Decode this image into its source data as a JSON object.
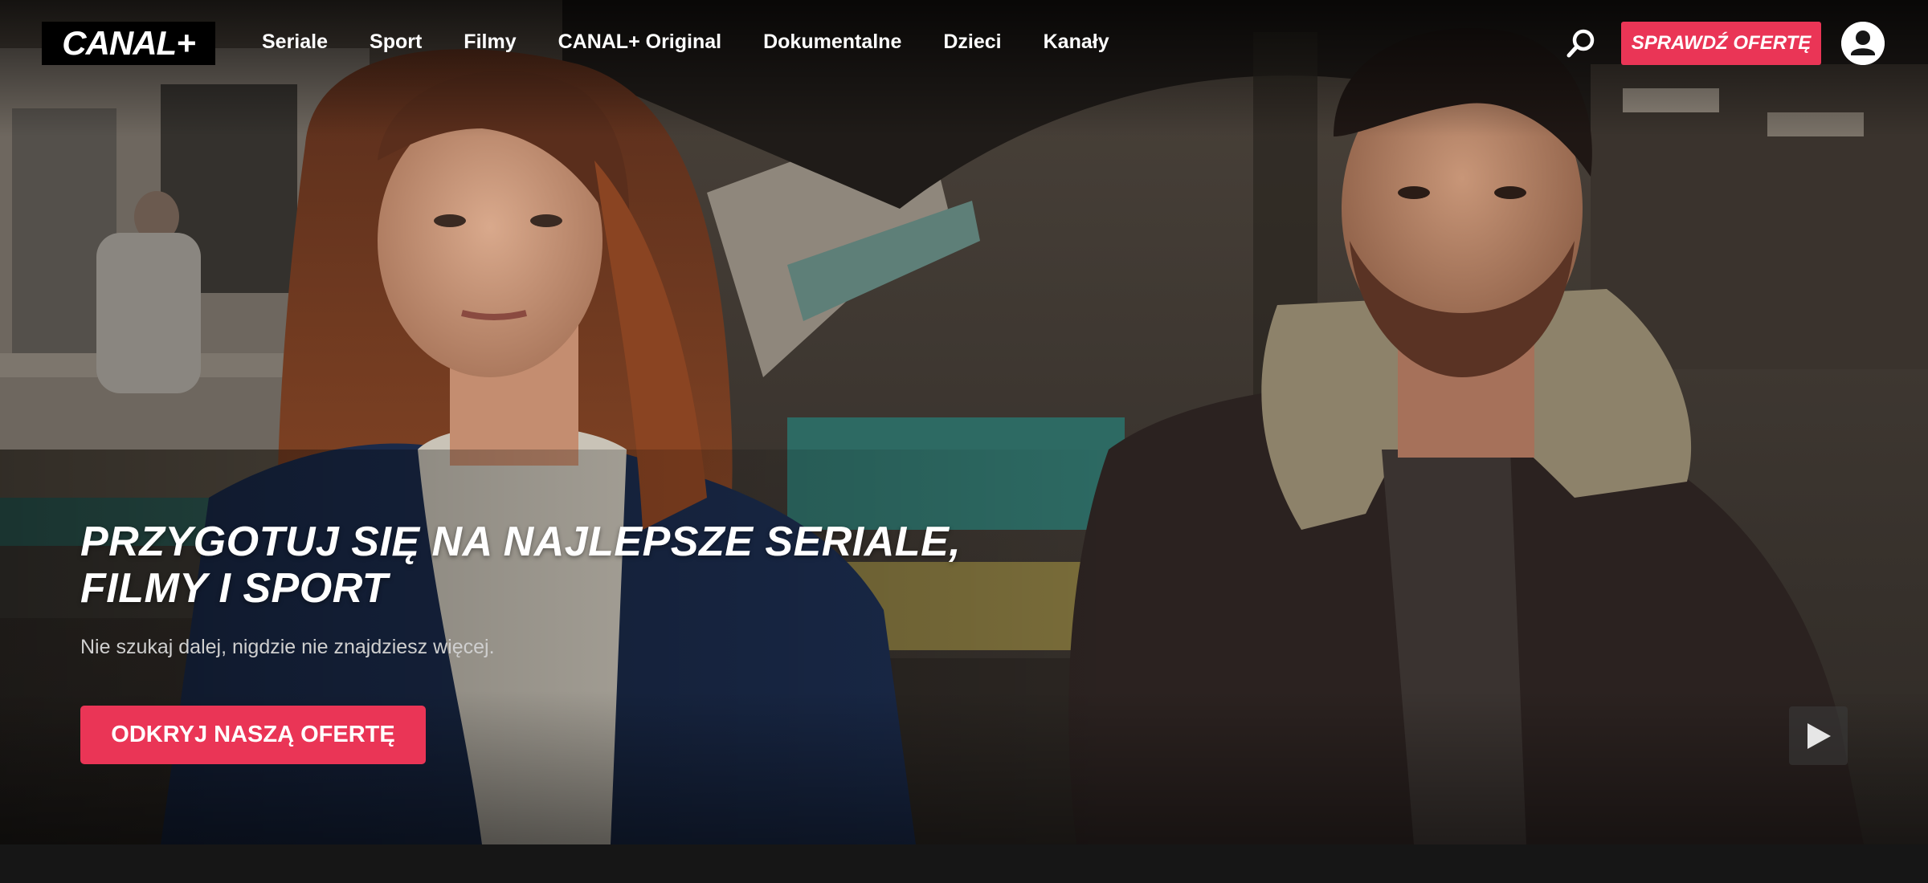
{
  "brand": {
    "logo_text": "CANAL+"
  },
  "nav": {
    "items": [
      {
        "label": "Seriale"
      },
      {
        "label": "Sport"
      },
      {
        "label": "Filmy"
      },
      {
        "label": "CANAL+ Original"
      },
      {
        "label": "Dokumentalne"
      },
      {
        "label": "Dzieci"
      },
      {
        "label": "Kanały"
      }
    ]
  },
  "header": {
    "offer_button": "SPRAWDŹ OFERTĘ",
    "search_icon": "search-icon",
    "account_icon": "user-account-icon"
  },
  "hero": {
    "title_line1": "PRZYGOTUJ SIĘ NA NAJLEPSZE SERIALE,",
    "title_line2": "FILMY I SPORT",
    "subtitle": "Nie szukaj dalej, nigdzie nie znajdziesz więcej.",
    "cta_label": "ODKRYJ NASZĄ OFERTĘ",
    "play_icon": "play-icon"
  },
  "colors": {
    "accent": "#ea3556",
    "header_text": "#ffffff",
    "subtitle_text": "#cfcfcf",
    "page_bg": "#161616"
  }
}
